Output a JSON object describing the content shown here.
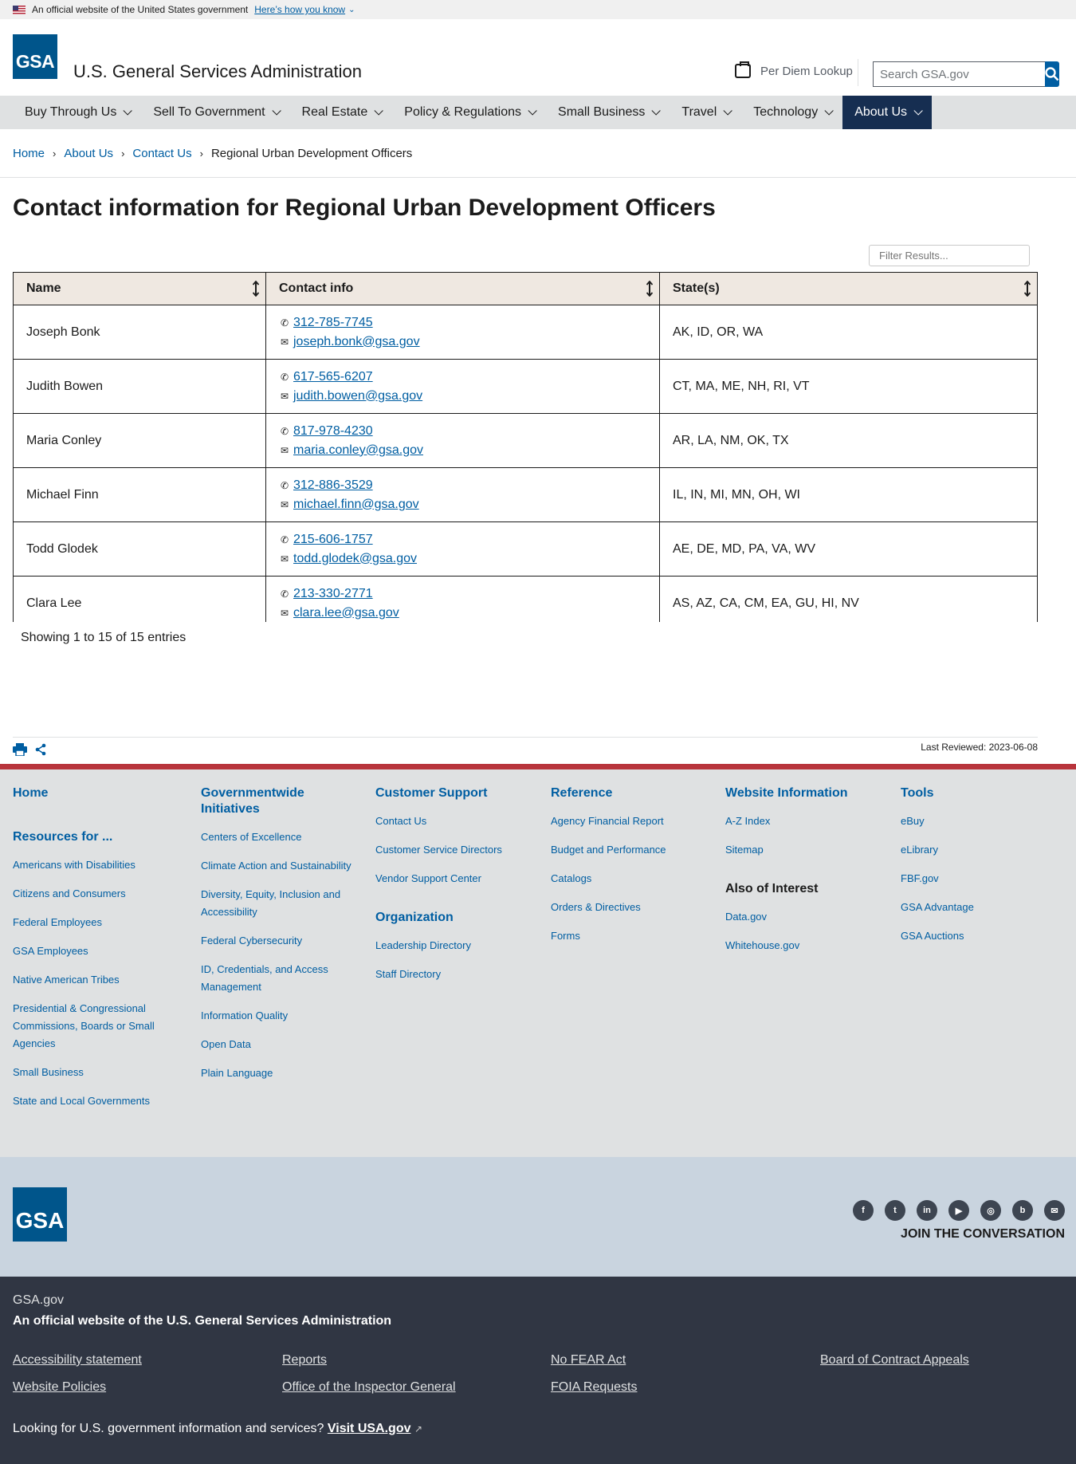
{
  "banner": {
    "text": "An official website of the United States government",
    "how_link": "Here’s how you know"
  },
  "header": {
    "logo": "GSA",
    "site_title": "U.S. General Services Administration",
    "per_diem": "Per Diem Lookup",
    "search_placeholder": "Search GSA.gov"
  },
  "nav": [
    {
      "label": "Buy Through Us"
    },
    {
      "label": "Sell To Government"
    },
    {
      "label": "Real Estate"
    },
    {
      "label": "Policy & Regulations"
    },
    {
      "label": "Small Business"
    },
    {
      "label": "Travel"
    },
    {
      "label": "Technology"
    },
    {
      "label": "About Us",
      "active": true
    }
  ],
  "breadcrumb": [
    "Home",
    "About Us",
    "Contact Us",
    "Regional Urban Development Officers"
  ],
  "page_title": "Contact information for Regional Urban Development Officers",
  "filter_placeholder": "Filter Results...",
  "table": {
    "headers": [
      "Name",
      "Contact info",
      "State(s)"
    ],
    "rows": [
      {
        "name": "Joseph Bonk",
        "phone": "312-785-7745",
        "email": "joseph.bonk@gsa.gov",
        "states": "AK, ID, OR, WA"
      },
      {
        "name": "Judith Bowen",
        "phone": "617-565-6207",
        "email": "judith.bowen@gsa.gov",
        "states": "CT, MA, ME, NH, RI, VT"
      },
      {
        "name": "Maria Conley",
        "phone": "817-978-4230",
        "email": "maria.conley@gsa.gov",
        "states": "AR, LA, NM, OK, TX"
      },
      {
        "name": "Michael Finn",
        "phone": "312-886-3529",
        "email": "michael.finn@gsa.gov",
        "states": "IL, IN, MI, MN, OH, WI"
      },
      {
        "name": "Todd Glodek",
        "phone": "215-606-1757",
        "email": "todd.glodek@gsa.gov",
        "states": "AE, DE, MD, PA, VA, WV"
      },
      {
        "name": "Clara Lee",
        "phone": "213-330-2771",
        "email": "clara.lee@gsa.gov",
        "states": "AS, AZ, CA, CM, EA, GU, HI, NV"
      }
    ],
    "showing": "Showing 1 to 15 of 15 entries"
  },
  "last_reviewed": "Last Reviewed: 2023-06-08",
  "footer": {
    "home": "Home",
    "resources_head": "Resources for ...",
    "resources": [
      "Americans with Disabilities",
      "Citizens and Consumers",
      "Federal Employees",
      "GSA Employees",
      "Native American Tribes",
      "Presidential & Congressional Commissions, Boards or Small Agencies",
      "Small Business",
      "State and Local Governments"
    ],
    "gov_head": "Governmentwide Initiatives",
    "gov": [
      "Centers of Excellence",
      "Climate Action and Sustainability",
      "Diversity, Equity, Inclusion and Accessibility",
      "Federal Cybersecurity",
      "ID, Credentials, and Access Management",
      "Information Quality",
      "Open Data",
      "Plain Language"
    ],
    "support_head": "Customer Support",
    "support": [
      "Contact Us",
      "Customer Service Directors",
      "Vendor Support Center"
    ],
    "org_head": "Organization",
    "org": [
      "Leadership Directory",
      "Staff Directory"
    ],
    "ref_head": "Reference",
    "ref": [
      "Agency Financial Report",
      "Budget and Performance",
      "Catalogs",
      "Orders & Directives",
      "Forms"
    ],
    "web_head": "Website Information",
    "web": [
      "A-Z Index",
      "Sitemap"
    ],
    "also_head": "Also of Interest",
    "also": [
      "Data.gov",
      "Whitehouse.gov"
    ],
    "tools_head": "Tools",
    "tools": [
      "eBuy",
      "eLibrary",
      "FBF.gov",
      "GSA Advantage",
      "GSA Auctions"
    ]
  },
  "social": {
    "icons": [
      "facebook-icon",
      "twitter-icon",
      "linkedin-icon",
      "youtube-icon",
      "instagram-icon",
      "blog-icon",
      "email-icon"
    ],
    "join": "JOIN THE CONVERSATION"
  },
  "bottom": {
    "site": "GSA.gov",
    "official": "An official website of the U.S. General Services Administration",
    "links": [
      "Accessibility statement",
      "Reports",
      "No FEAR Act",
      "Board of Contract Appeals",
      "Website Policies",
      "Office of the Inspector General",
      "FOIA Requests"
    ],
    "looking": "Looking for U.S. government information and services?",
    "visit": "Visit USA.gov"
  }
}
